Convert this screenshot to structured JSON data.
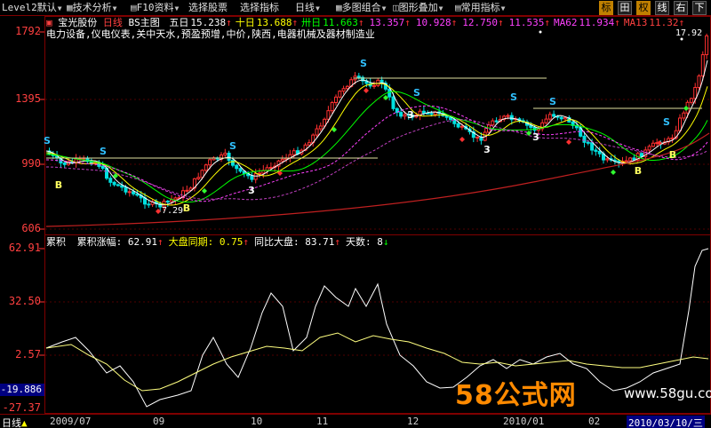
{
  "toolbar": {
    "menus": [
      {
        "label": "Level2默认",
        "caret": true
      },
      {
        "label": "技术分析",
        "caret": true
      },
      {
        "label": "F10资料",
        "caret": true
      },
      {
        "label": "选择股票",
        "caret": false
      },
      {
        "label": "选择指标",
        "caret": false
      },
      {
        "label": "日线",
        "caret": true
      },
      {
        "label": "多图组合",
        "caret": true
      },
      {
        "label": "图形叠加",
        "caret": true
      },
      {
        "label": "常用指标",
        "caret": true
      }
    ],
    "right_buttons": [
      "标",
      "田",
      "权",
      "线",
      "右",
      "下"
    ]
  },
  "info": {
    "stock_name": "宝光股份",
    "period": "日线",
    "indicator": "BS主图",
    "ma_items": [
      {
        "label": "五日",
        "value": "15.238",
        "color": "#ffffff"
      },
      {
        "label": "十日",
        "value": "13.688",
        "color": "#ffff00"
      },
      {
        "label": "卅日",
        "value": "11.663",
        "color": "#00ff00"
      },
      {
        "label": "",
        "value": "13.357",
        "color": "#ff40ff"
      },
      {
        "label": "",
        "value": "10.928",
        "color": "#ff40ff"
      },
      {
        "label": "",
        "value": "12.750",
        "color": "#ff40ff"
      },
      {
        "label": "",
        "value": "11.535",
        "color": "#ff40ff"
      },
      {
        "label": "MA62",
        "value": "11.934",
        "color": "#ff40ff"
      },
      {
        "label": "MA13",
        "value": "11.32",
        "color": "#ff4040"
      }
    ]
  },
  "industry": "电力设备,仪电仪表,关中天水,预盈预增,中价,陕西,电器机械及器材制造业",
  "main_axis": [
    "1792",
    "1395",
    "990",
    "606"
  ],
  "price_annotations": {
    "high": "17.92",
    "low": "7.29"
  },
  "sub_axis": [
    "62.91",
    "32.50",
    "2.57",
    "-19.886",
    "-27.37"
  ],
  "sub_info": {
    "name": "累积",
    "items": [
      {
        "label": "累积涨幅",
        "value": "62.91",
        "arrow": "↑",
        "color": "#ffffff"
      },
      {
        "label": "大盘同期",
        "value": "0.75",
        "arrow": "↑",
        "color": "#ffff00"
      },
      {
        "label": "同比大盘",
        "value": "83.71",
        "arrow": "↑",
        "color": "#ffffff"
      },
      {
        "label": "天数",
        "value": "8",
        "arrow": "↓",
        "color": "#ffffff"
      }
    ]
  },
  "bottom": {
    "period_label": "日线",
    "dates": [
      "2009/07",
      "09",
      "10",
      "11",
      "12",
      "2010/01",
      "02",
      "2010/03/10/三"
    ]
  },
  "signals": {
    "buy": "B",
    "sell": "S",
    "num": "3"
  },
  "watermark": {
    "main": "58公式网",
    "url": "www.58gu.com"
  },
  "colors": {
    "up": "#ff3030",
    "down": "#00e0e0",
    "frame": "#800000",
    "ma5": "#ffffff",
    "ma10": "#ffff00",
    "ma30": "#00ff00",
    "ma60": "#ff40ff"
  }
}
